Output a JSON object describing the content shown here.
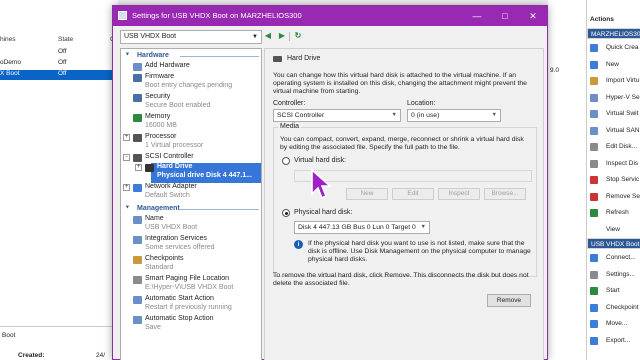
{
  "window_title": "Settings for USB VHDX Boot on MARZHELIOS300",
  "background": {
    "vm_list_header": {
      "name": "hines",
      "state": "State",
      "cpu": "C"
    },
    "vm_rows": [
      {
        "name": "",
        "state": "Off",
        "cpu": "",
        "selected": false
      },
      {
        "name": "oDemo",
        "state": "Off",
        "cpu": "",
        "selected": false
      },
      {
        "name": "X Boot",
        "state": "Off",
        "cpu": "",
        "selected": true
      }
    ],
    "details_title": "Boot",
    "created_label": "Created:",
    "created_value": "24/",
    "middle_version": "9.0"
  },
  "actions": {
    "title": "Actions",
    "host_group": "MARZHELIOS300",
    "host_items": [
      {
        "label": "Quick Crea",
        "icon_color": "#3b7dd8"
      },
      {
        "label": "New",
        "icon_color": "#3b7dd8"
      },
      {
        "label": "Import Virtu",
        "icon_color": "#c89a3a"
      },
      {
        "label": "Hyper-V Se",
        "icon_color": "#6b8fc7"
      },
      {
        "label": "Virtual Swit",
        "icon_color": "#6b8fc7"
      },
      {
        "label": "Virtual SAN",
        "icon_color": "#6b8fc7"
      },
      {
        "label": "Edit Disk...",
        "icon_color": "#8a8a8a"
      },
      {
        "label": "Inspect Dis",
        "icon_color": "#8a8a8a"
      },
      {
        "label": "Stop Servic",
        "icon_color": "#cc3333"
      },
      {
        "label": "Remove Se",
        "icon_color": "#cc3333"
      },
      {
        "label": "Refresh",
        "icon_color": "#2b8a3e"
      },
      {
        "label": "View",
        "icon_color": "#ffffff"
      }
    ],
    "vm_group": "USB VHDX Boot",
    "vm_items": [
      {
        "label": "Connect...",
        "icon_color": "#3b7dd8"
      },
      {
        "label": "Settings...",
        "icon_color": "#8a8a8a"
      },
      {
        "label": "Start",
        "icon_color": "#2b8a3e"
      },
      {
        "label": "Checkpoint",
        "icon_color": "#3b7dd8"
      },
      {
        "label": "Move...",
        "icon_color": "#3b7dd8"
      },
      {
        "label": "Export...",
        "icon_color": "#3b7dd8"
      }
    ]
  },
  "dialog": {
    "vm_selector": "USB VHDX Boot",
    "tree": {
      "hardware_section": "Hardware",
      "management_section": "Management",
      "hardware_items": [
        {
          "title": "Add Hardware",
          "subtitle": "",
          "icon_color": "#6b8fc7"
        },
        {
          "title": "Firmware",
          "subtitle": "Boot entry changes pending",
          "icon_color": "#4a6fa5"
        },
        {
          "title": "Security",
          "subtitle": "Secure Boot enabled",
          "icon_color": "#4a6fa5"
        },
        {
          "title": "Memory",
          "subtitle": "16000 MB",
          "icon_color": "#2b8a3e"
        },
        {
          "title": "Processor",
          "subtitle": "1 Virtual processor",
          "icon_color": "#555555"
        },
        {
          "title": "SCSI Controller",
          "subtitle": "",
          "icon_color": "#555555"
        },
        {
          "title": "Hard Drive",
          "subtitle": "Physical drive Disk 4 447.1...",
          "icon_color": "#333333"
        },
        {
          "title": "Network Adapter",
          "subtitle": "Default Switch",
          "icon_color": "#3b7dd8"
        }
      ],
      "management_items": [
        {
          "title": "Name",
          "subtitle": "USB VHDX Boot",
          "icon_color": "#6b8fc7"
        },
        {
          "title": "Integration Services",
          "subtitle": "Some services offered",
          "icon_color": "#6b8fc7"
        },
        {
          "title": "Checkpoints",
          "subtitle": "Standard",
          "icon_color": "#c89a3a"
        },
        {
          "title": "Smart Paging File Location",
          "subtitle": "E:\\Hyper-V\\USB VHDX Boot",
          "icon_color": "#8a8a8a"
        },
        {
          "title": "Automatic Start Action",
          "subtitle": "Restart if previously running",
          "icon_color": "#6b8fc7"
        },
        {
          "title": "Automatic Stop Action",
          "subtitle": "Save",
          "icon_color": "#6b8fc7"
        }
      ]
    },
    "panel": {
      "heading": "Hard Drive",
      "intro": [
        "You can change how this virtual hard disk is attached to the virtual machine. If an",
        "operating system is installed on this disk, changing the attachment might prevent the",
        "virtual machine from starting."
      ],
      "controller_label": "Controller:",
      "controller_value": "SCSI Controller",
      "location_label": "Location:",
      "location_value": "0 (in use)",
      "media_label": "Media",
      "media_text": [
        "You can compact, convert, expand, merge, reconnect or shrink a virtual hard disk",
        "by editing the associated file. Specify the full path to the file."
      ],
      "vhd_label": "Virtual hard disk:",
      "buttons": {
        "new": "New",
        "edit": "Edit",
        "inspect": "Inspect",
        "browse": "Browse..."
      },
      "phys_label": "Physical hard disk:",
      "phys_value": "Disk 4 447.13 GB Bus 0 Lun 0 Target 0",
      "info_text": [
        "If the physical hard disk you want to use is not listed, make sure that the",
        "disk is offline. Use Disk Management on the physical computer to manage",
        "physical hard disks."
      ],
      "remove_text": [
        "To remove the virtual hard disk, click Remove. This disconnects the disk but does not",
        "delete the associated file."
      ],
      "remove_button": "Remove"
    }
  }
}
